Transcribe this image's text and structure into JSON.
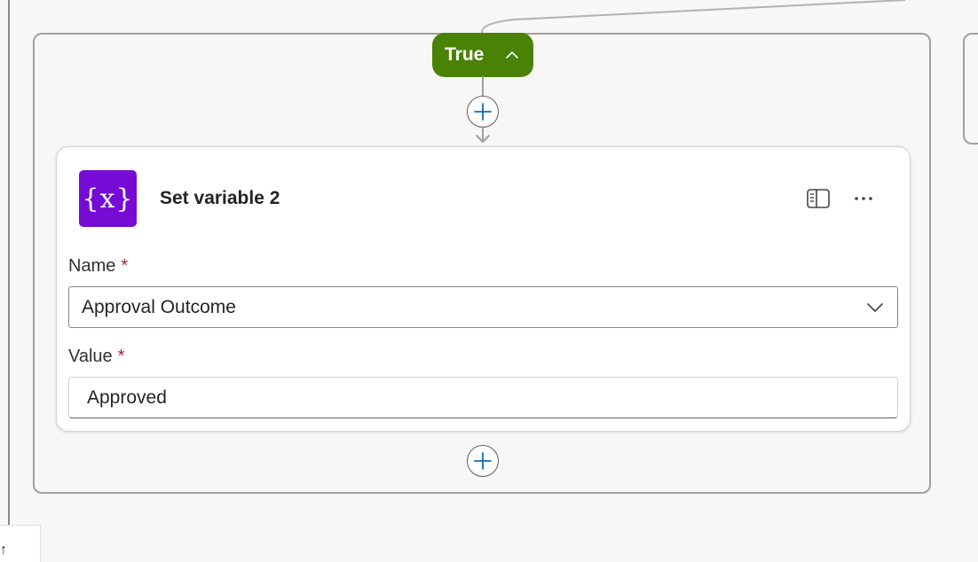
{
  "branch": {
    "label": "True"
  },
  "action": {
    "title": "Set variable 2",
    "icon": "variable-icon",
    "icon_glyph": "{x}",
    "icon_color": "#770bd6"
  },
  "fields": {
    "name": {
      "label": "Name",
      "required_mark": "*",
      "value": "Approval Outcome"
    },
    "value": {
      "label": "Value",
      "required_mark": "*",
      "value": "Approved"
    }
  },
  "colors": {
    "branch_true": "#498205",
    "required": "#a4262c"
  },
  "icons": [
    "chevron-up-icon",
    "plus-icon",
    "panel-icon",
    "more-icon",
    "chevron-down-icon",
    "arrow-up-icon"
  ]
}
